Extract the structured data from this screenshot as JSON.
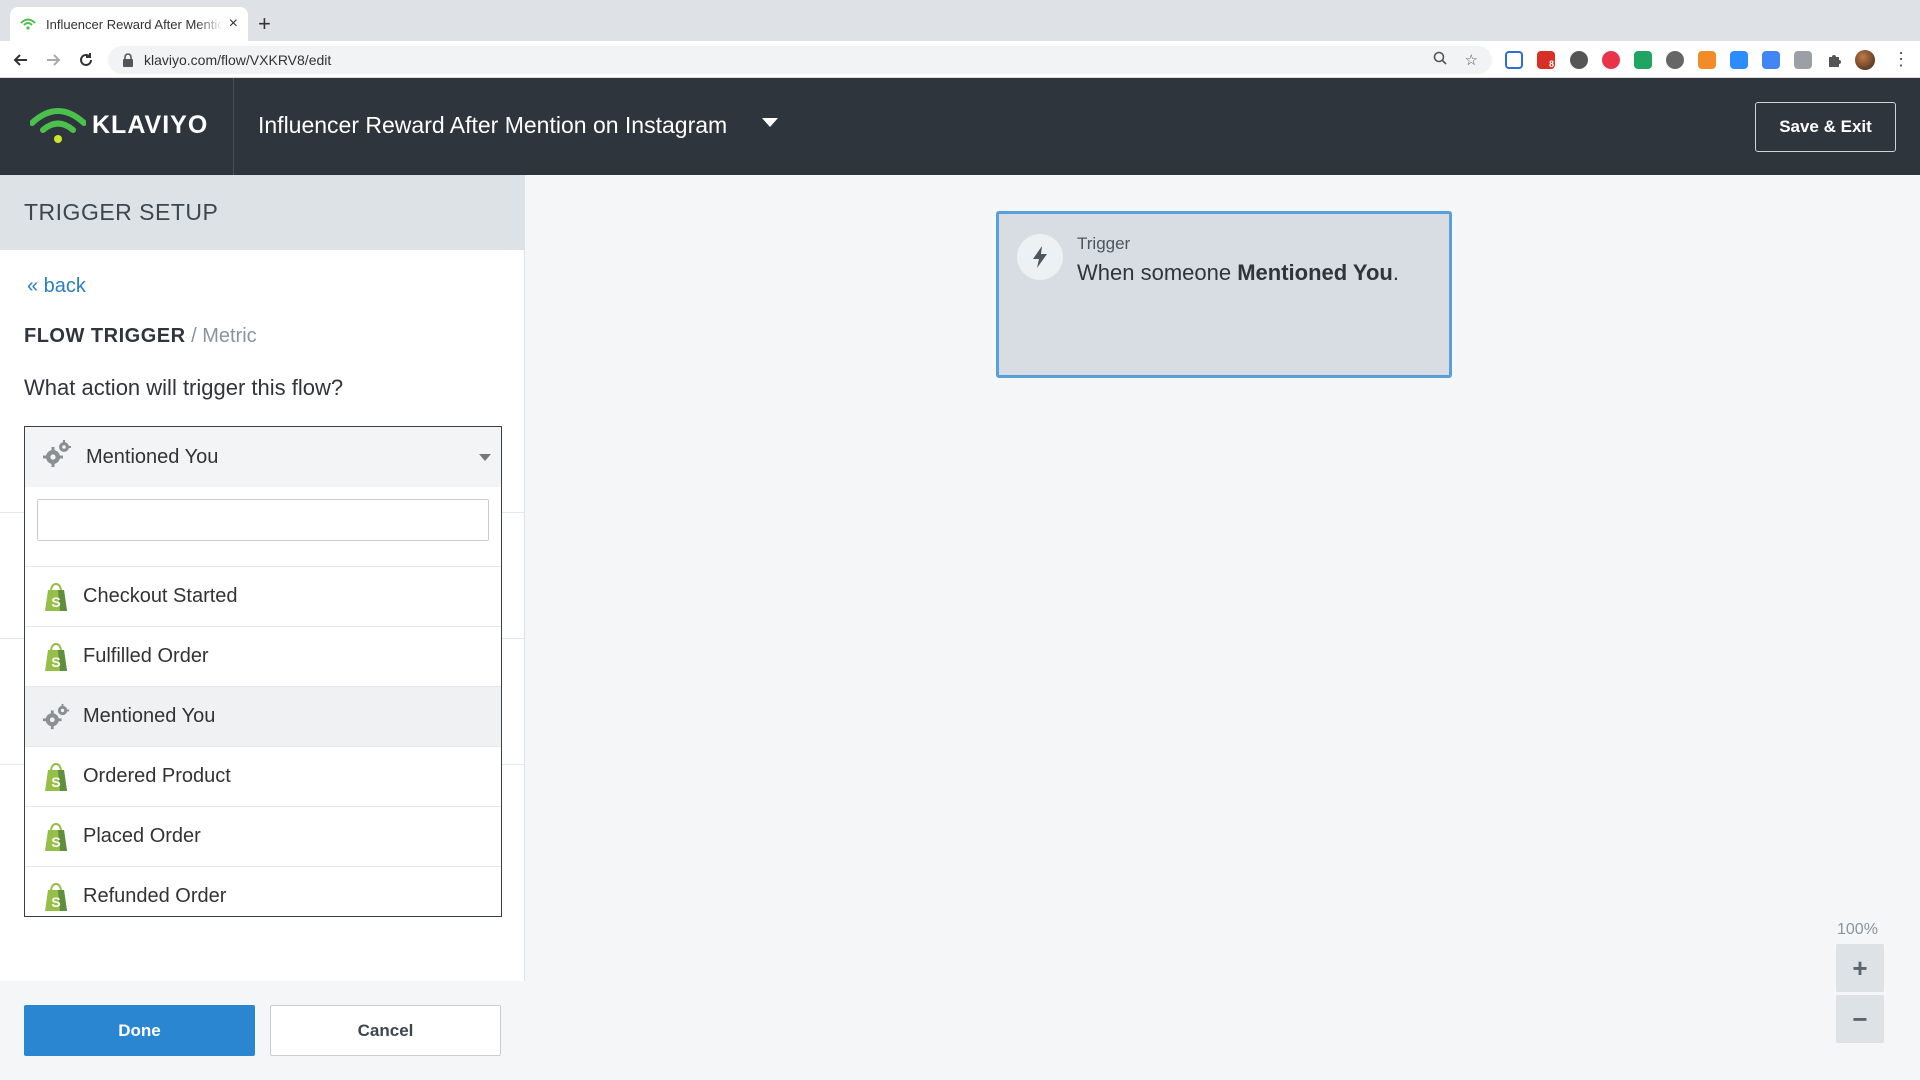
{
  "browser": {
    "tab_title": "Influencer Reward After Mention on Instagram",
    "tab_close": "×",
    "new_tab": "+",
    "url": "klaviyo.com/flow/VXKRV8/edit",
    "extension_badge": "8"
  },
  "header": {
    "logo_text": "KLAVIYO",
    "flow_title": "Influencer Reward After Mention on Instagram",
    "save_exit_label": "Save & Exit"
  },
  "panel": {
    "title": "TRIGGER SETUP",
    "back_label": "« back",
    "section_title": "FLOW TRIGGER",
    "section_sub": " / Metric",
    "question": "What action will trigger this flow?",
    "dropdown": {
      "selected": "Mentioned You",
      "search_value": "",
      "items": [
        {
          "label": "Checkout Started",
          "icon": "shopify-icon"
        },
        {
          "label": "Fulfilled Order",
          "icon": "shopify-icon"
        },
        {
          "label": "Mentioned You",
          "icon": "cog-icon"
        },
        {
          "label": "Ordered Product",
          "icon": "shopify-icon"
        },
        {
          "label": "Placed Order",
          "icon": "shopify-icon"
        },
        {
          "label": "Refunded Order",
          "icon": "shopify-icon"
        }
      ]
    },
    "done_label": "Done",
    "cancel_label": "Cancel"
  },
  "canvas": {
    "trigger_label": "Trigger",
    "trigger_prefix": "When someone ",
    "trigger_metric": "Mentioned You",
    "trigger_suffix": ".",
    "zoom_level": "100%",
    "zoom_in": "+",
    "zoom_out": "−"
  },
  "colors": {
    "header_bg": "#2e353c",
    "accent_blue": "#2a86d1",
    "klaviyo_green": "#4bc14b",
    "shopify_green": "#95bf47"
  }
}
